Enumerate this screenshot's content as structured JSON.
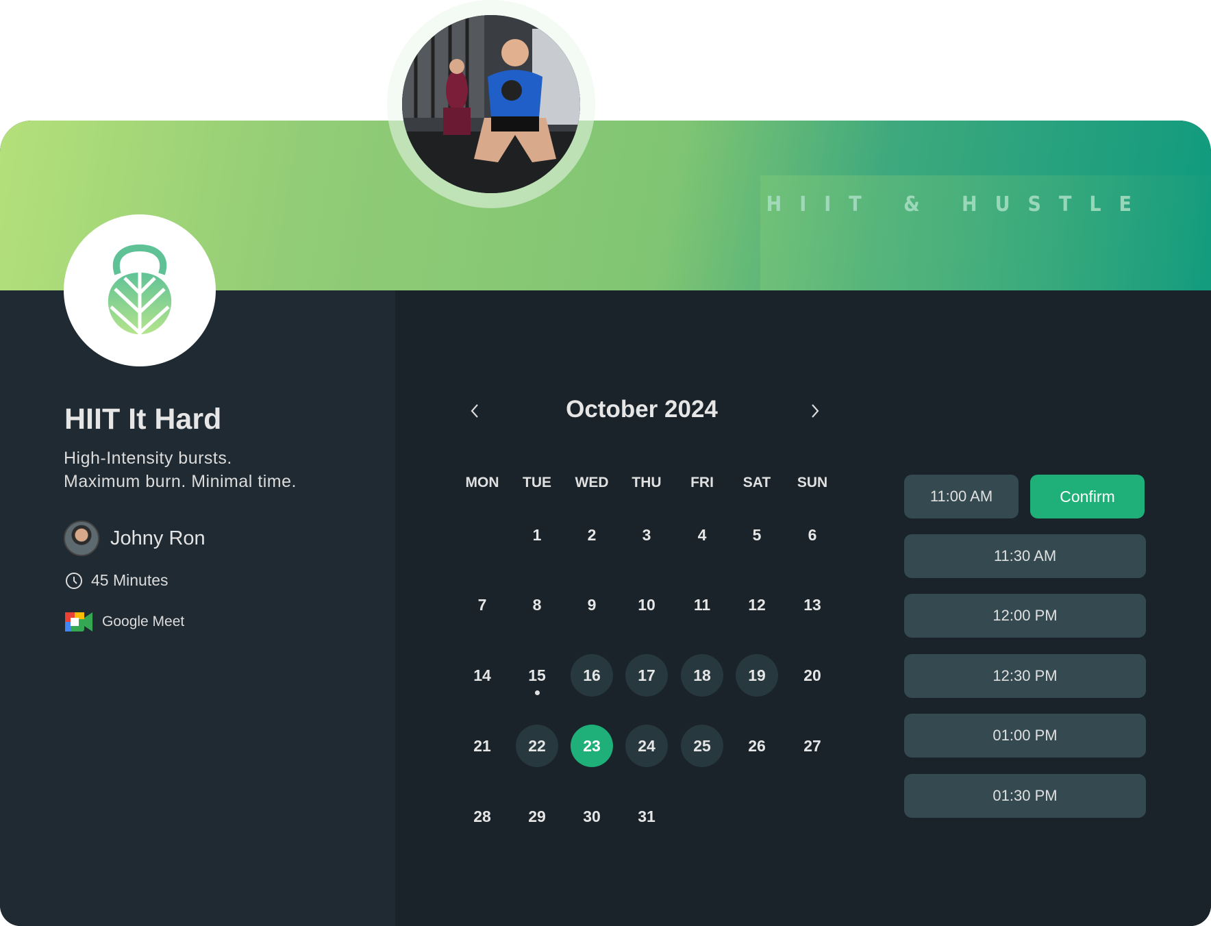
{
  "brand": {
    "wordmark": "HIIT & HUSTLE",
    "accent": "#1faf78"
  },
  "event": {
    "title": "HIIT It Hard",
    "description_lines": [
      "High-Intensity bursts.",
      "Maximum burn. Minimal time."
    ],
    "host": "Johny Ron",
    "duration": "45 Minutes",
    "location": "Google Meet"
  },
  "calendar": {
    "month_label": "October 2024",
    "prev_icon": "chevron-left-icon",
    "next_icon": "chevron-right-icon",
    "weekdays": [
      "MON",
      "TUE",
      "WED",
      "THU",
      "FRI",
      "SAT",
      "SUN"
    ],
    "first_weekday_index": 1,
    "days_in_month": 31,
    "today": 15,
    "available": [
      16,
      17,
      18,
      19,
      22,
      24,
      25
    ],
    "selected": 23
  },
  "slots": {
    "selected": "11:00 AM",
    "confirm_label": "Confirm",
    "others": [
      "11:30 AM",
      "12:00 PM",
      "12:30 PM",
      "01:00 PM",
      "01:30 PM"
    ]
  }
}
